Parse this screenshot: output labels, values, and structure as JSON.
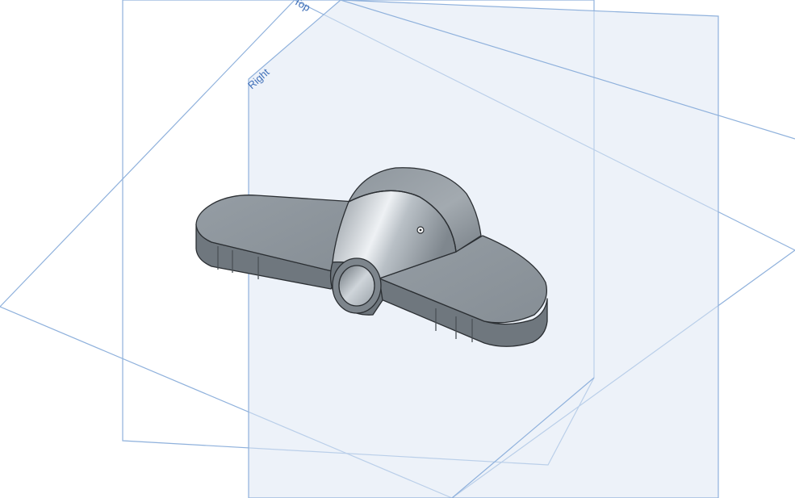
{
  "viewport": {
    "planes": {
      "top_label": "Top",
      "right_label": "Right"
    },
    "colors": {
      "background": "#ffffff",
      "plane_fill": "#dfe8f4",
      "plane_stroke": "#8fb1dc",
      "label": "#3f6fb8",
      "part_body": "#8f979e",
      "part_edge": "#2b2f33"
    },
    "part": {
      "name_icon": "wing-nut-part",
      "origin_icon": "origin-marker-icon"
    }
  }
}
